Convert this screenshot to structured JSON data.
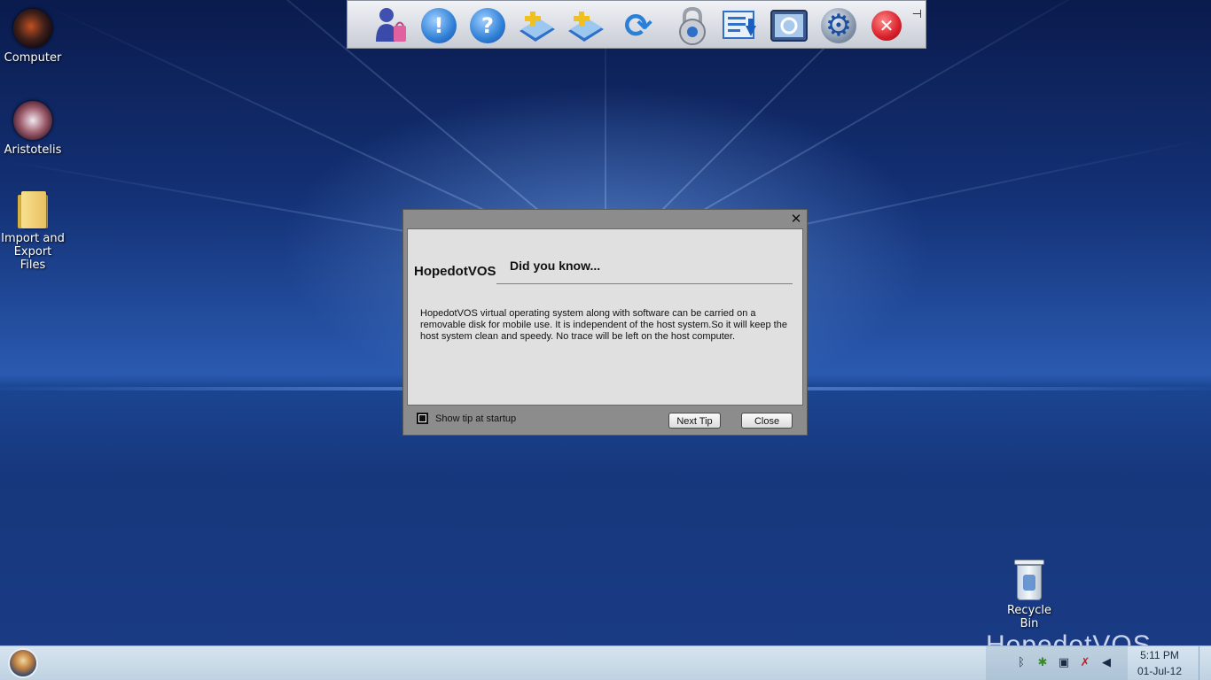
{
  "desktop": {
    "icons": [
      {
        "label": "Computer",
        "icon": "computer-orb-icon"
      },
      {
        "label": "Aristotelis",
        "icon": "user-orb-icon"
      },
      {
        "label": "Import and",
        "label2": "Export Files",
        "icon": "folder-icon"
      },
      {
        "label": "Recycle Bin",
        "icon": "recycle-bin-icon"
      }
    ],
    "brand_watermark": "HopedotVOS",
    "colors": {
      "background_top": "#0a1b4d",
      "background_mid": "#2a5ab0",
      "glow": "#78aaf0"
    }
  },
  "toolbar": {
    "buttons": [
      {
        "icon": "users-icon",
        "color": "#3a4aa8"
      },
      {
        "icon": "alert-icon",
        "color": "#2f7fd6",
        "glyph": "!"
      },
      {
        "icon": "help-icon",
        "color": "#2f7fd6",
        "glyph": "?"
      },
      {
        "icon": "import-icon",
        "color": "#2f6fc8"
      },
      {
        "icon": "export-icon",
        "color": "#2f6fc8"
      },
      {
        "icon": "sync-icon",
        "color": "#2a80d8",
        "glyph": "⟳"
      },
      {
        "icon": "lock-icon",
        "color": "#8a8f98"
      },
      {
        "icon": "download-list-icon",
        "color": "#2f6fc8"
      },
      {
        "icon": "control-panel-icon",
        "color": "#3a5a90"
      },
      {
        "icon": "settings-icon",
        "color": "#5a7090",
        "glyph": "⚙"
      },
      {
        "icon": "close-icon",
        "color": "#d8202a",
        "glyph": "✕"
      }
    ],
    "pin_icon": "pin-icon"
  },
  "dialog": {
    "app_name": "HopedotVOS",
    "heading": "Did you know...",
    "tip_text": "HopedotVOS virtual operating system along with software can be carried on a removable disk for mobile use. It is independent of the host system.So it will keep the host system clean and speedy. No trace will be left on the host computer.",
    "show_tip_label": "Show tip at startup",
    "show_tip_checked": true,
    "next_tip_label": "Next Tip",
    "close_label": "Close"
  },
  "taskbar": {
    "tray_icons": [
      "bluetooth-icon",
      "network-device-icon",
      "clipboard-icon",
      "network-disconnected-icon",
      "volume-icon"
    ],
    "clock_time": "5:11 PM",
    "clock_date": "01-Jul-12"
  }
}
